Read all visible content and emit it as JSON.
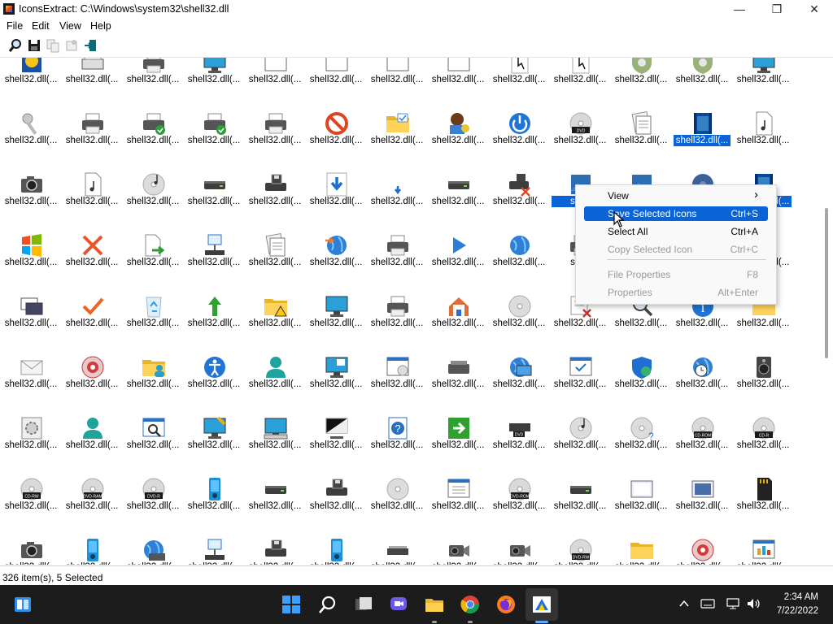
{
  "window": {
    "title": "IconsExtract:   C:\\Windows\\system32\\shell32.dll",
    "minimize_glyph": "—",
    "maximize_glyph": "❐",
    "close_glyph": "✕"
  },
  "menu": {
    "items": [
      "File",
      "Edit",
      "View",
      "Help"
    ]
  },
  "toolbar": {
    "buttons": [
      "search-icon",
      "save-icon",
      "copy-icon",
      "properties-icon",
      "exit-icon"
    ]
  },
  "icon_grid": {
    "cell_label": "shell32.dll(...",
    "partial_label": "shell",
    "rows": [
      [
        "lock-badge-icon",
        "keyboard-icon",
        "printer-desk-icon",
        "monitor-icon",
        "control-panel-icon",
        "dialog-icon",
        "blank-window-icon",
        "blank-window-icon",
        "hand-cursor-icon",
        "cursor-doc-icon",
        "shield-gear-icon",
        "shield-gear-icon",
        "monitor-blue-icon"
      ],
      [
        "keys-icon",
        "printer-icon",
        "printer-check-icon",
        "printer-check-icon",
        "printer-icon",
        "prohibited-icon",
        "folder-check-icon",
        "user-key-icon",
        "power-icon",
        "dvd-icon",
        "documents-icon",
        "film-icon",
        "music-file-icon"
      ],
      [
        "camera-icon",
        "media-file-icon",
        "cd-music-icon",
        "drive-icon",
        "floppy-drive-icon",
        "download-icon",
        "small-download-icon",
        "drive-icon",
        "drive-delete-icon",
        "picture-icon",
        "picture-icon",
        "disc-blue-icon",
        "video-icon"
      ],
      [
        "windows-logo-icon",
        "delete-x-icon",
        "file-export-icon",
        "network-drive-icon",
        "documents-stack-icon",
        "globe-arrow-icon",
        "printer-icon",
        "play-icon",
        "globe-music-icon",
        "printer-icon",
        "",
        "",
        ""
      ],
      [
        "images-stack-icon",
        "checkmark-icon",
        "recycle-bin-icon",
        "up-arrow-icon",
        "folder-warning-icon",
        "monitor-icon",
        "printer-icon",
        "home-network-icon",
        "cd-icon",
        "task-delete-icon",
        "magnifier-icon",
        "info-icon",
        "folder-icon"
      ],
      [
        "mail-icon",
        "cd-red-icon",
        "folder-users-icon",
        "accessibility-icon",
        "user-icon",
        "monitor-grid-icon",
        "window-cd-icon",
        "scanner-icon",
        "globe-monitor-icon",
        "check-window-icon",
        "shield-globe-icon",
        "globe-clock-icon",
        "speaker-icon"
      ],
      [
        "gear-file-icon",
        "user-teal-icon",
        "search-window-icon",
        "pen-monitor-icon",
        "keyboard-monitor-icon",
        "monitor-dark-icon",
        "help-icon",
        "go-arrow-icon",
        "dvd-drive-icon",
        "cd-music-icon",
        "cd-question-icon",
        "cd-rom-icon",
        "cd-r-icon"
      ],
      [
        "cd-rw-icon",
        "dvd-ram-icon",
        "dvd-r-icon",
        "mp3-player-icon",
        "drive-icon",
        "floppy-drive-icon",
        "cd-icon",
        "document-window-icon",
        "dvd-rom-icon",
        "drive-icon",
        "printer-frame-icon",
        "tablet-icon",
        "sd-card-icon"
      ],
      [
        "camera-icon",
        "phone-icon",
        "globe-printer-icon",
        "network-drive-icon",
        "floppy-drive-icon",
        "phone-icon",
        "scanner-flat-icon",
        "projector-icon",
        "camcorder-icon",
        "dvd-rw-icon",
        "folder-icon",
        "cd-red-icon",
        "chart-window-icon"
      ]
    ],
    "disc_texts": {
      "dvd": "DVD",
      "cd_rom": "CD-ROM",
      "cd_r": "CD-R",
      "cd_rw": "CD-RW",
      "dvd_ram": "DVD-RAM",
      "dvd_r": "DVD-R",
      "dvd_rom": "DVD-ROM",
      "dvd_rw": "DVD-RW"
    }
  },
  "context_menu": {
    "items": [
      {
        "label": "View",
        "shortcut": "›",
        "state": "normal"
      },
      {
        "label": "Save Selected Icons",
        "shortcut": "Ctrl+S",
        "state": "highlighted"
      },
      {
        "label": "Select All",
        "shortcut": "Ctrl+A",
        "state": "normal"
      },
      {
        "label": "Copy Selected Icon",
        "shortcut": "Ctrl+C",
        "state": "disabled"
      },
      {
        "label": "File Properties",
        "shortcut": "F8",
        "state": "disabled"
      },
      {
        "label": "Properties",
        "shortcut": "Alt+Enter",
        "state": "disabled"
      }
    ]
  },
  "status": {
    "text": "326 item(s), 5 Selected"
  },
  "taskbar": {
    "apps": [
      "start-icon",
      "search-icon",
      "task-view-icon",
      "chat-icon",
      "file-explorer-icon",
      "chrome-icon",
      "firefox-icon",
      "iconsextract-icon"
    ],
    "pinned_left": "widgets-icon",
    "tray_icons": [
      "chevron-up-icon",
      "keyboard-icon",
      "network-icon",
      "volume-icon"
    ],
    "time": "2:34 AM",
    "date": "7/22/2022"
  },
  "colors": {
    "selection": "#0a64d8",
    "taskbar": "#1c1c1c",
    "menu_bg": "#f9f9f9"
  }
}
